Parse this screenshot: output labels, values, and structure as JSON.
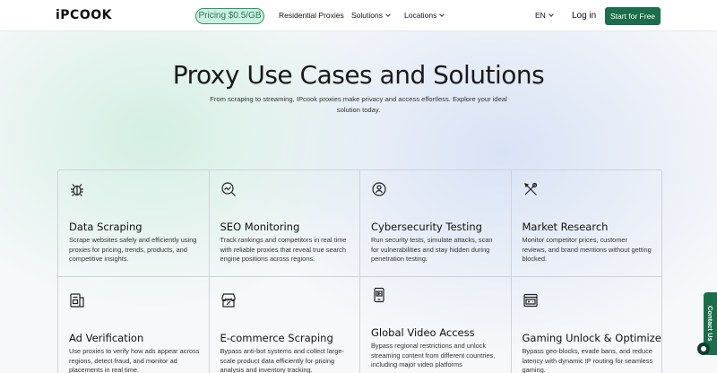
{
  "nav": {
    "logo": "iPCOOK",
    "pricing": "Pricing $0.5/GB",
    "links": [
      "Residential Proxies",
      "Solutions",
      "Locations"
    ],
    "lang": "EN",
    "login": "Log in",
    "cta": "Start for Free"
  },
  "hero": {
    "title": "Proxy Use Cases and Solutions",
    "subtitle": "From scraping to streaming, IPcook proxies make privacy and access effortless. Explore your ideal solution today."
  },
  "cards": [
    {
      "icon": "bug-icon",
      "title": "Data Scraping",
      "desc": "Scrape websites safely and efficiently using proxies for pricing, trends, products, and competitive insights."
    },
    {
      "icon": "search-chart-icon",
      "title": "SEO Monitoring",
      "desc": "Track rankings and competitors in real time with reliable proxies that reveal true search engine positions across regions."
    },
    {
      "icon": "shield-user-icon",
      "title": "Cybersecurity Testing",
      "desc": "Run security tests, simulate attacks, scan for vulnerabilities and stay hidden during penetration testing."
    },
    {
      "icon": "tools-icon",
      "title": "Market Research",
      "desc": "Monitor competitor prices, customer reviews, and brand mentions without getting blocked."
    },
    {
      "icon": "ad-icon",
      "title": "Ad Verification",
      "desc": "Use proxies to verify how ads appear across regions, detect fraud, and monitor ad placements in real time."
    },
    {
      "icon": "store-icon",
      "title": "E-commerce Scraping",
      "desc": "Bypass anti-bot systems and collect large-scale product data efficiently for pricing analysis and inventory tracking."
    },
    {
      "icon": "video-icon",
      "title": "Global Video Access",
      "desc": "Bypass regional restrictions and unlock streaming content from different countries, including major video platforms"
    },
    {
      "icon": "gaming-icon",
      "title": "Gaming Unlock & Optimize",
      "desc": "Bypass geo-blocks, evade bans, and reduce latency with dynamic IP routing for seamless gaming."
    }
  ],
  "contact": "Contact Us"
}
